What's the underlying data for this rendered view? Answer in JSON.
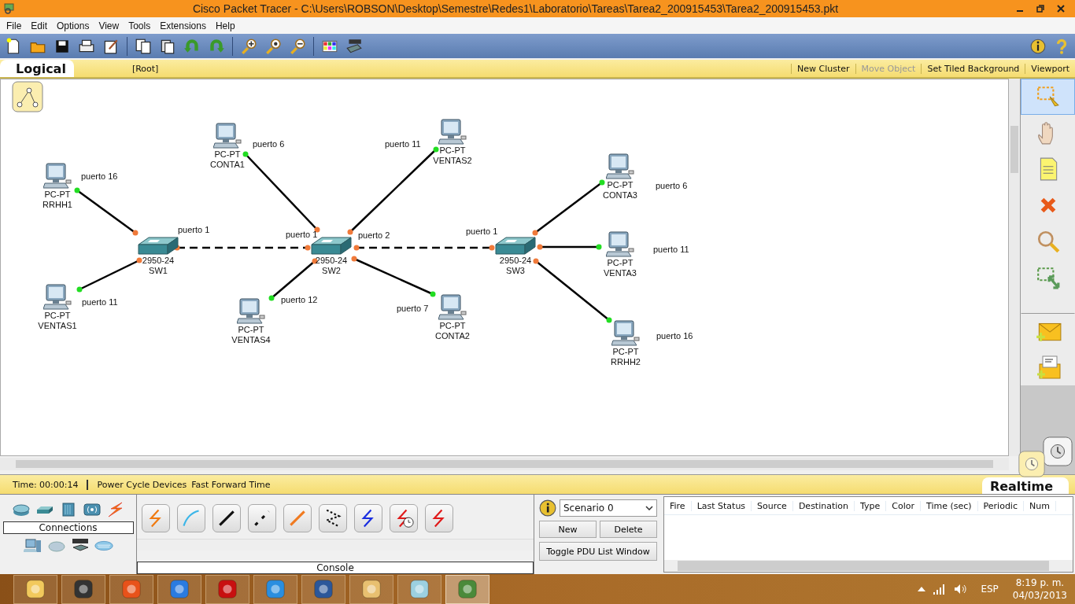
{
  "window": {
    "title": "Cisco Packet Tracer - C:\\Users\\ROBSON\\Desktop\\Semestre\\Redes1\\Laboratorio\\Tareas\\Tarea2_200915453\\Tarea2_200915453.pkt"
  },
  "menu": [
    "File",
    "Edit",
    "Options",
    "View",
    "Tools",
    "Extensions",
    "Help"
  ],
  "workspace_bar": {
    "mode": "Logical",
    "path": "[Root]",
    "actions": [
      {
        "label": "New Cluster",
        "disabled": false
      },
      {
        "label": "Move Object",
        "disabled": true
      },
      {
        "label": "Set Tiled Background",
        "disabled": false
      },
      {
        "label": "Viewport",
        "disabled": false
      }
    ]
  },
  "diagram": {
    "devices": [
      {
        "kind": "switch",
        "model": "2950-24",
        "name": "SW1"
      },
      {
        "kind": "switch",
        "model": "2950-24",
        "name": "SW2"
      },
      {
        "kind": "switch",
        "model": "2950-24",
        "name": "SW3"
      },
      {
        "kind": "pc",
        "model": "PC-PT",
        "name": "RRHH1"
      },
      {
        "kind": "pc",
        "model": "PC-PT",
        "name": "VENTAS1"
      },
      {
        "kind": "pc",
        "model": "PC-PT",
        "name": "CONTA1"
      },
      {
        "kind": "pc",
        "model": "PC-PT",
        "name": "VENTAS4"
      },
      {
        "kind": "pc",
        "model": "PC-PT",
        "name": "VENTAS2"
      },
      {
        "kind": "pc",
        "model": "PC-PT",
        "name": "CONTA2"
      },
      {
        "kind": "pc",
        "model": "PC-PT",
        "name": "CONTA3"
      },
      {
        "kind": "pc",
        "model": "PC-PT",
        "name": "VENTA3"
      },
      {
        "kind": "pc",
        "model": "PC-PT",
        "name": "RRHH2"
      }
    ],
    "links": [
      {
        "kind": "straight"
      },
      {
        "kind": "straight"
      },
      {
        "kind": "crossover"
      },
      {
        "kind": "straight"
      },
      {
        "kind": "straight"
      },
      {
        "kind": "straight"
      },
      {
        "kind": "straight"
      },
      {
        "kind": "crossover"
      },
      {
        "kind": "straight"
      },
      {
        "kind": "straight"
      },
      {
        "kind": "straight"
      }
    ],
    "port_labels": [
      "puerto 16",
      "puerto 11",
      "puerto 1",
      "puerto 6",
      "puerto 1",
      "puerto 2",
      "puerto 12",
      "puerto 11",
      "puerto 7",
      "puerto 1",
      "puerto 6",
      "puerto 11",
      "puerto 16"
    ]
  },
  "tools": [
    {
      "kind": "select",
      "selected": true
    },
    {
      "kind": "move",
      "selected": false
    },
    {
      "kind": "note",
      "selected": false
    },
    {
      "kind": "delete",
      "selected": false
    },
    {
      "kind": "inspect",
      "selected": false
    },
    {
      "kind": "resize",
      "selected": false
    },
    {
      "kind": "simple-pdu",
      "selected": false
    },
    {
      "kind": "complex-pdu",
      "selected": false
    }
  ],
  "status_bar": {
    "time": "Time: 00:00:14",
    "actions": [
      "Power Cycle Devices",
      "Fast Forward Time"
    ],
    "mode": "Realtime"
  },
  "device_panel": {
    "category": "Connections",
    "cables": [
      {
        "kind": "automatic"
      },
      {
        "kind": "console"
      },
      {
        "kind": "straight"
      },
      {
        "kind": "crossover"
      },
      {
        "kind": "fiber"
      },
      {
        "kind": "phone"
      },
      {
        "kind": "coaxial"
      },
      {
        "kind": "serial-dce"
      },
      {
        "kind": "serial-dte"
      }
    ],
    "device_label": "Console"
  },
  "scenario": {
    "value": "Scenario 0",
    "buttons": [
      "New",
      "Delete"
    ],
    "toggle": "Toggle PDU List Window"
  },
  "pdu_table": {
    "columns": [
      "Fire",
      "Last Status",
      "Source",
      "Destination",
      "Type",
      "Color",
      "Time (sec)",
      "Periodic",
      "Num"
    ]
  },
  "taskbar": {
    "apps": [
      {
        "kind": "folder",
        "active": false
      },
      {
        "kind": "dial",
        "active": false
      },
      {
        "kind": "browser",
        "active": false
      },
      {
        "kind": "waves",
        "active": false
      },
      {
        "kind": "pdf",
        "active": false
      },
      {
        "kind": "music",
        "active": false
      },
      {
        "kind": "word",
        "active": false
      },
      {
        "kind": "paint",
        "active": false
      },
      {
        "kind": "notepad",
        "active": false
      },
      {
        "kind": "tracer",
        "active": true
      }
    ],
    "language": "ESP",
    "time": "8:19 p. m.",
    "date": "04/03/2013"
  }
}
